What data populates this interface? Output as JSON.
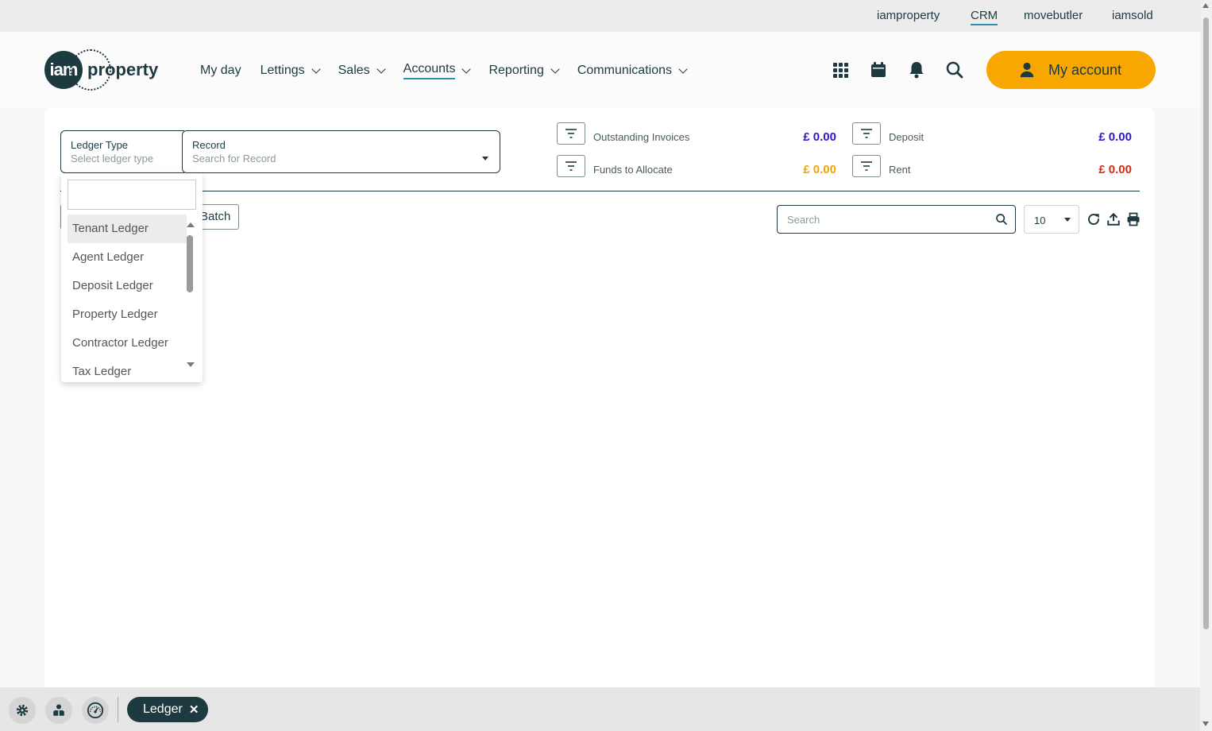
{
  "top_links": [
    "iamproperty",
    "CRM",
    "movebutler",
    "iamsold"
  ],
  "logo": {
    "mark": "iam",
    "word": "property"
  },
  "nav": [
    {
      "label": "My day",
      "has_menu": false
    },
    {
      "label": "Lettings",
      "has_menu": true
    },
    {
      "label": "Sales",
      "has_menu": true
    },
    {
      "label": "Accounts",
      "has_menu": true,
      "active": true
    },
    {
      "label": "Reporting",
      "has_menu": true
    },
    {
      "label": "Communications",
      "has_menu": true
    }
  ],
  "header_icons": [
    "apps-grid-icon",
    "calendar-icon",
    "bell-icon",
    "search-icon"
  ],
  "account_button": {
    "label": "My account",
    "icon": "user-icon",
    "color": "#f7a700"
  },
  "filters": {
    "ledger_type": {
      "label": "Ledger Type",
      "placeholder": "Select ledger type"
    },
    "record": {
      "label": "Record",
      "placeholder": "Search for Record"
    }
  },
  "stats": [
    {
      "label": "Outstanding Invoices",
      "value": "£ 0.00",
      "color": "#2b18c8"
    },
    {
      "label": "Funds to Allocate",
      "value": "£ 0.00",
      "color": "#f0a500"
    },
    {
      "label": "Deposit",
      "value": "£ 0.00",
      "color": "#2b18c8"
    },
    {
      "label": "Rent",
      "value": "£ 0.00",
      "color": "#d62a10"
    }
  ],
  "batch_button": "Batch",
  "table_search": {
    "placeholder": "Search"
  },
  "page_size": "10",
  "toolbar_icons": [
    "refresh-icon",
    "export-icon",
    "print-icon"
  ],
  "dropdown": {
    "options": [
      "Tenant Ledger",
      "Agent Ledger",
      "Deposit Ledger",
      "Property Ledger",
      "Contractor Ledger",
      "Tax Ledger"
    ],
    "highlighted": "Tenant Ledger"
  },
  "taskbar": {
    "icons": [
      "settings-icon",
      "support-icon",
      "dashboard-gauge-icon"
    ],
    "tab": "Ledger"
  },
  "colors": {
    "brand_dark": "#1d3a40",
    "accent_link": "#2a8fb0"
  }
}
